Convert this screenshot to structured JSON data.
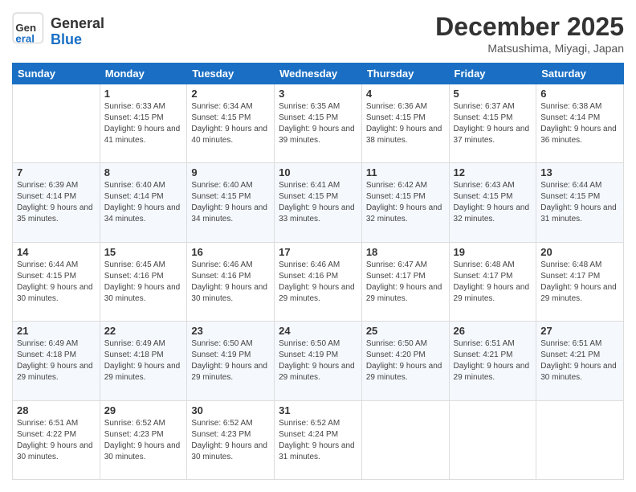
{
  "header": {
    "logo_general": "General",
    "logo_blue": "Blue",
    "month_title": "December 2025",
    "location": "Matsushima, Miyagi, Japan"
  },
  "days_of_week": [
    "Sunday",
    "Monday",
    "Tuesday",
    "Wednesday",
    "Thursday",
    "Friday",
    "Saturday"
  ],
  "weeks": [
    [
      {
        "day": "",
        "sunrise": "",
        "sunset": "",
        "daylight": ""
      },
      {
        "day": "1",
        "sunrise": "Sunrise: 6:33 AM",
        "sunset": "Sunset: 4:15 PM",
        "daylight": "Daylight: 9 hours and 41 minutes."
      },
      {
        "day": "2",
        "sunrise": "Sunrise: 6:34 AM",
        "sunset": "Sunset: 4:15 PM",
        "daylight": "Daylight: 9 hours and 40 minutes."
      },
      {
        "day": "3",
        "sunrise": "Sunrise: 6:35 AM",
        "sunset": "Sunset: 4:15 PM",
        "daylight": "Daylight: 9 hours and 39 minutes."
      },
      {
        "day": "4",
        "sunrise": "Sunrise: 6:36 AM",
        "sunset": "Sunset: 4:15 PM",
        "daylight": "Daylight: 9 hours and 38 minutes."
      },
      {
        "day": "5",
        "sunrise": "Sunrise: 6:37 AM",
        "sunset": "Sunset: 4:15 PM",
        "daylight": "Daylight: 9 hours and 37 minutes."
      },
      {
        "day": "6",
        "sunrise": "Sunrise: 6:38 AM",
        "sunset": "Sunset: 4:14 PM",
        "daylight": "Daylight: 9 hours and 36 minutes."
      }
    ],
    [
      {
        "day": "7",
        "sunrise": "Sunrise: 6:39 AM",
        "sunset": "Sunset: 4:14 PM",
        "daylight": "Daylight: 9 hours and 35 minutes."
      },
      {
        "day": "8",
        "sunrise": "Sunrise: 6:40 AM",
        "sunset": "Sunset: 4:14 PM",
        "daylight": "Daylight: 9 hours and 34 minutes."
      },
      {
        "day": "9",
        "sunrise": "Sunrise: 6:40 AM",
        "sunset": "Sunset: 4:15 PM",
        "daylight": "Daylight: 9 hours and 34 minutes."
      },
      {
        "day": "10",
        "sunrise": "Sunrise: 6:41 AM",
        "sunset": "Sunset: 4:15 PM",
        "daylight": "Daylight: 9 hours and 33 minutes."
      },
      {
        "day": "11",
        "sunrise": "Sunrise: 6:42 AM",
        "sunset": "Sunset: 4:15 PM",
        "daylight": "Daylight: 9 hours and 32 minutes."
      },
      {
        "day": "12",
        "sunrise": "Sunrise: 6:43 AM",
        "sunset": "Sunset: 4:15 PM",
        "daylight": "Daylight: 9 hours and 32 minutes."
      },
      {
        "day": "13",
        "sunrise": "Sunrise: 6:44 AM",
        "sunset": "Sunset: 4:15 PM",
        "daylight": "Daylight: 9 hours and 31 minutes."
      }
    ],
    [
      {
        "day": "14",
        "sunrise": "Sunrise: 6:44 AM",
        "sunset": "Sunset: 4:15 PM",
        "daylight": "Daylight: 9 hours and 30 minutes."
      },
      {
        "day": "15",
        "sunrise": "Sunrise: 6:45 AM",
        "sunset": "Sunset: 4:16 PM",
        "daylight": "Daylight: 9 hours and 30 minutes."
      },
      {
        "day": "16",
        "sunrise": "Sunrise: 6:46 AM",
        "sunset": "Sunset: 4:16 PM",
        "daylight": "Daylight: 9 hours and 30 minutes."
      },
      {
        "day": "17",
        "sunrise": "Sunrise: 6:46 AM",
        "sunset": "Sunset: 4:16 PM",
        "daylight": "Daylight: 9 hours and 29 minutes."
      },
      {
        "day": "18",
        "sunrise": "Sunrise: 6:47 AM",
        "sunset": "Sunset: 4:17 PM",
        "daylight": "Daylight: 9 hours and 29 minutes."
      },
      {
        "day": "19",
        "sunrise": "Sunrise: 6:48 AM",
        "sunset": "Sunset: 4:17 PM",
        "daylight": "Daylight: 9 hours and 29 minutes."
      },
      {
        "day": "20",
        "sunrise": "Sunrise: 6:48 AM",
        "sunset": "Sunset: 4:17 PM",
        "daylight": "Daylight: 9 hours and 29 minutes."
      }
    ],
    [
      {
        "day": "21",
        "sunrise": "Sunrise: 6:49 AM",
        "sunset": "Sunset: 4:18 PM",
        "daylight": "Daylight: 9 hours and 29 minutes."
      },
      {
        "day": "22",
        "sunrise": "Sunrise: 6:49 AM",
        "sunset": "Sunset: 4:18 PM",
        "daylight": "Daylight: 9 hours and 29 minutes."
      },
      {
        "day": "23",
        "sunrise": "Sunrise: 6:50 AM",
        "sunset": "Sunset: 4:19 PM",
        "daylight": "Daylight: 9 hours and 29 minutes."
      },
      {
        "day": "24",
        "sunrise": "Sunrise: 6:50 AM",
        "sunset": "Sunset: 4:19 PM",
        "daylight": "Daylight: 9 hours and 29 minutes."
      },
      {
        "day": "25",
        "sunrise": "Sunrise: 6:50 AM",
        "sunset": "Sunset: 4:20 PM",
        "daylight": "Daylight: 9 hours and 29 minutes."
      },
      {
        "day": "26",
        "sunrise": "Sunrise: 6:51 AM",
        "sunset": "Sunset: 4:21 PM",
        "daylight": "Daylight: 9 hours and 29 minutes."
      },
      {
        "day": "27",
        "sunrise": "Sunrise: 6:51 AM",
        "sunset": "Sunset: 4:21 PM",
        "daylight": "Daylight: 9 hours and 30 minutes."
      }
    ],
    [
      {
        "day": "28",
        "sunrise": "Sunrise: 6:51 AM",
        "sunset": "Sunset: 4:22 PM",
        "daylight": "Daylight: 9 hours and 30 minutes."
      },
      {
        "day": "29",
        "sunrise": "Sunrise: 6:52 AM",
        "sunset": "Sunset: 4:23 PM",
        "daylight": "Daylight: 9 hours and 30 minutes."
      },
      {
        "day": "30",
        "sunrise": "Sunrise: 6:52 AM",
        "sunset": "Sunset: 4:23 PM",
        "daylight": "Daylight: 9 hours and 30 minutes."
      },
      {
        "day": "31",
        "sunrise": "Sunrise: 6:52 AM",
        "sunset": "Sunset: 4:24 PM",
        "daylight": "Daylight: 9 hours and 31 minutes."
      },
      {
        "day": "",
        "sunrise": "",
        "sunset": "",
        "daylight": ""
      },
      {
        "day": "",
        "sunrise": "",
        "sunset": "",
        "daylight": ""
      },
      {
        "day": "",
        "sunrise": "",
        "sunset": "",
        "daylight": ""
      }
    ]
  ]
}
